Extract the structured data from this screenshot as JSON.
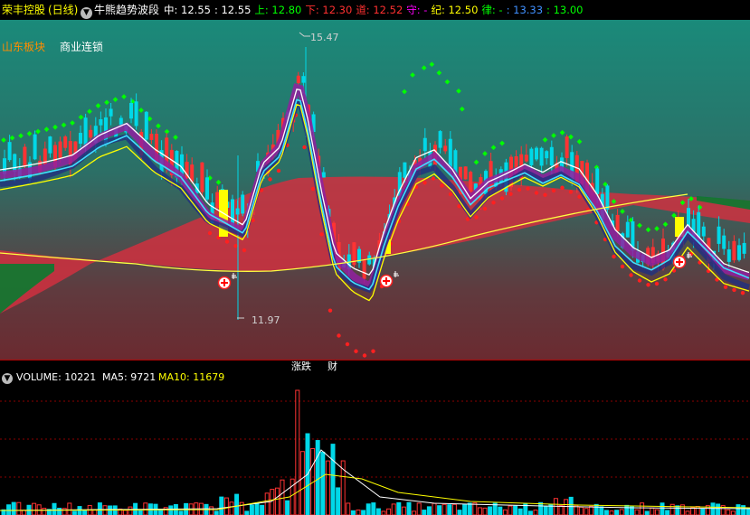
{
  "header": {
    "stock_name": "荣丰控股",
    "period": "(日线)",
    "indicator_name": "牛熊趋势波段",
    "fields": [
      {
        "label": "中:",
        "value": "12.55",
        "color": "#ffffff"
      },
      {
        "label": ":",
        "value": "12.55",
        "color": "#ffffff"
      },
      {
        "label": "上:",
        "value": "12.80",
        "color": "#00ff00"
      },
      {
        "label": "下:",
        "value": "12.30",
        "color": "#ff3030"
      },
      {
        "label": "道:",
        "value": "12.52",
        "color": "#ff3030"
      },
      {
        "label": "守:",
        "value": "-",
        "color": "#ff00ff"
      },
      {
        "label": "纪:",
        "value": "12.50",
        "color": "#ffff00"
      },
      {
        "label": "律:",
        "value": "-",
        "color": "#00ff00"
      },
      {
        "label": ":",
        "value": "13.33",
        "color": "#4090ff"
      },
      {
        "label": ":",
        "value": "13.00",
        "color": "#00ff00"
      }
    ]
  },
  "tags": {
    "sector": "山东板块",
    "concept": "商业连锁"
  },
  "price_labels": {
    "high": "15.47",
    "low": "11.97"
  },
  "tabs": {
    "tab1": "涨跌",
    "tab2": "财"
  },
  "volume": {
    "title": "VOLUME: 10221",
    "ma5": "MA5: 9721",
    "ma10": "MA10: 11679"
  },
  "colors": {
    "up": "#ff3333",
    "down": "#00d8e8",
    "ma5": "#ffffff",
    "ma10": "#ffff00",
    "trail_dot_up": "#00ff00",
    "trail_dot_down": "#ff2020",
    "cloud": "#d03040",
    "accent_label": "#ff8c00"
  },
  "icons": [
    "dropdown-caret-icon",
    "buy-signal-icon"
  ]
}
